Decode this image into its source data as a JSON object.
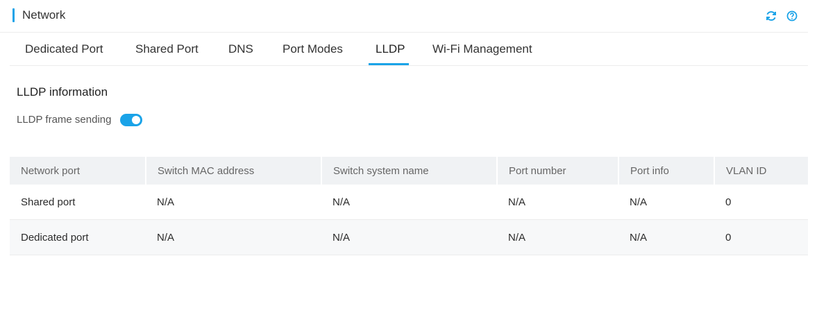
{
  "header": {
    "title": "Network",
    "accent_color": "#1aa3e8",
    "icons": [
      "refresh-icon",
      "help-icon"
    ]
  },
  "tabs": [
    {
      "label": "Dedicated Port",
      "active": false
    },
    {
      "label": "Shared Port",
      "active": false
    },
    {
      "label": "DNS",
      "active": false
    },
    {
      "label": "Port Modes",
      "active": false
    },
    {
      "label": "LLDP",
      "active": true
    },
    {
      "label": "Wi-Fi Management",
      "active": false
    }
  ],
  "lldp": {
    "section_title": "LLDP information",
    "frame_sending_label": "LLDP frame sending",
    "frame_sending_enabled": true
  },
  "table": {
    "headers": [
      "Network port",
      "Switch MAC address",
      "Switch system name",
      "Port number",
      "Port info",
      "VLAN ID"
    ],
    "rows": [
      [
        "Shared port",
        "N/A",
        "N/A",
        "N/A",
        "N/A",
        "0"
      ],
      [
        "Dedicated port",
        "N/A",
        "N/A",
        "N/A",
        "N/A",
        "0"
      ]
    ]
  }
}
